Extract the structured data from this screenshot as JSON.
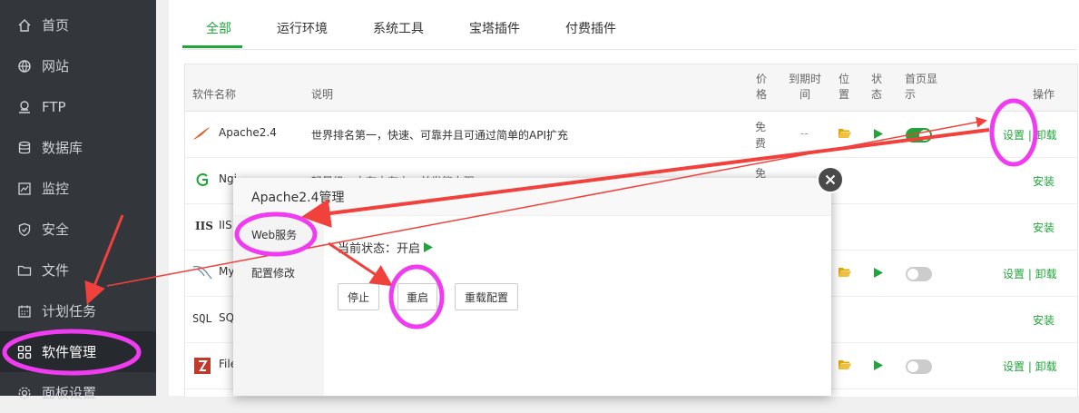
{
  "sidebar": {
    "items": [
      {
        "label": "首页",
        "icon": "home-icon"
      },
      {
        "label": "网站",
        "icon": "globe-icon"
      },
      {
        "label": "FTP",
        "icon": "ftp-icon"
      },
      {
        "label": "数据库",
        "icon": "database-icon"
      },
      {
        "label": "监控",
        "icon": "monitor-icon"
      },
      {
        "label": "安全",
        "icon": "shield-icon"
      },
      {
        "label": "文件",
        "icon": "folder-icon"
      },
      {
        "label": "计划任务",
        "icon": "calendar-icon"
      },
      {
        "label": "软件管理",
        "icon": "grid-icon"
      },
      {
        "label": "面板设置",
        "icon": "gear-icon"
      }
    ]
  },
  "tabs": [
    "全部",
    "运行环境",
    "系统工具",
    "宝塔插件",
    "付费插件"
  ],
  "table": {
    "headers": {
      "name": "软件名称",
      "desc": "说明",
      "price": "价格",
      "expire": "到期时间",
      "location": "位置",
      "status": "状态",
      "homepage": "首页显示",
      "action": "操作"
    },
    "rows": [
      {
        "name": "Apache2.4",
        "desc": "世界排名第一，快速、可靠并且可通过简单的API扩充",
        "price": "免费",
        "expire": "--",
        "action": "设置 | 卸载"
      },
      {
        "name": "Ngi",
        "desc": "轻量级，占有内存少，并发能力强",
        "price": "免",
        "action": "安装"
      },
      {
        "name": "IIS",
        "action": "安装"
      },
      {
        "name": "My",
        "action": "设置 | 卸载"
      },
      {
        "name": "SQ",
        "action": "安装"
      },
      {
        "name": "File",
        "action": "设置 | 卸载"
      }
    ]
  },
  "modal": {
    "title": "Apache2.4管理",
    "menu": [
      "Web服务",
      "配置修改"
    ],
    "status_label": "当前状态：开启",
    "buttons": {
      "stop": "停止",
      "restart": "重启",
      "reload": "重载配置"
    }
  },
  "colors": {
    "accent": "#20a53a",
    "annotation": "#f03cf0",
    "arrow": "#f0413c"
  }
}
